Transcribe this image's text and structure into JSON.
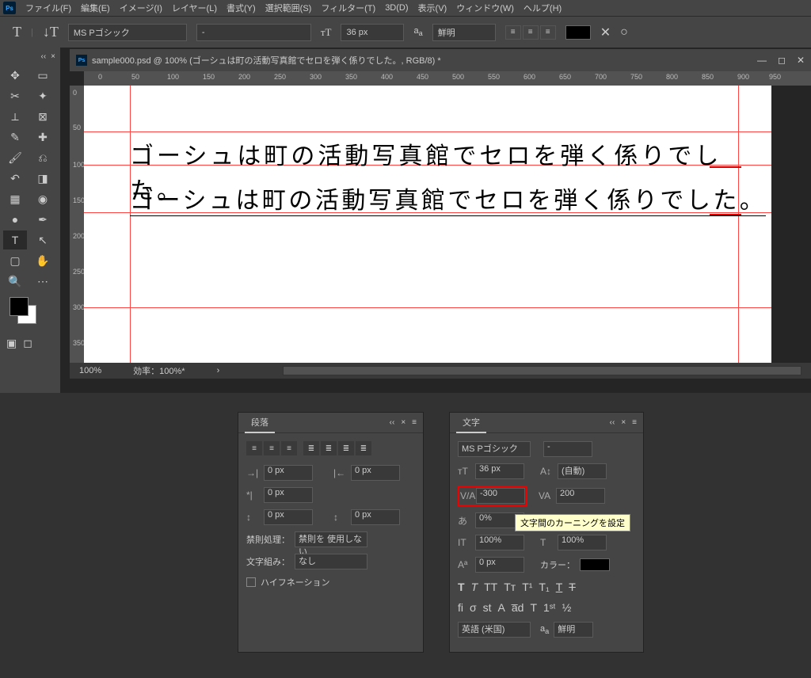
{
  "menu": {
    "items": [
      "ファイル(F)",
      "編集(E)",
      "イメージ(I)",
      "レイヤー(L)",
      "書式(Y)",
      "選択範囲(S)",
      "フィルター(T)",
      "3D(D)",
      "表示(V)",
      "ウィンドウ(W)",
      "ヘルプ(H)"
    ]
  },
  "optbar": {
    "font": "MS Pゴシック",
    "style": "-",
    "size": "36 px",
    "aa": "鮮明"
  },
  "doc": {
    "title": "sample000.psd @ 100% (ゴーシュは町の活動写真館でセロを弾く係りでした。, RGB/8) *",
    "zoom": "100%",
    "eff": "効率：100%*"
  },
  "rulerH": [
    "0",
    "50",
    "100",
    "150",
    "200",
    "250",
    "300",
    "350",
    "400",
    "450",
    "500",
    "550",
    "600",
    "650",
    "700",
    "750",
    "800",
    "850",
    "900",
    "950"
  ],
  "rulerV": [
    "0",
    "50",
    "100",
    "150",
    "200",
    "250",
    "300",
    "350"
  ],
  "canvas": {
    "text1": "ゴーシュは町の活動写真館でセロを弾く係りでした。",
    "text2": "ゴーシュは町の活動写真館でセロを弾く係りでした。"
  },
  "para": {
    "title": "段落",
    "indentL": "0 px",
    "indentR": "0 px",
    "indentF": "0 px",
    "spaceBefore": "0 px",
    "spaceAfter": "0 px",
    "kinsoku_lbl": "禁則処理：",
    "kinsoku": "禁則を 使用しない",
    "moji_lbl": "文字組み：",
    "moji": "なし",
    "hyph": "ハイフネーション"
  },
  "char": {
    "title": "文字",
    "font": "MS Pゴシック",
    "style": "-",
    "size": "36 px",
    "leading": "(自動)",
    "kerning": "-300",
    "tracking": "200",
    "tsume": "0%",
    "vscale": "100%",
    "hscale": "100%",
    "baseline": "0 px",
    "color_lbl": "カラー：",
    "lang": "英語 (米国)",
    "aa": "鮮明",
    "tooltip": "文字間のカーニングを設定"
  }
}
